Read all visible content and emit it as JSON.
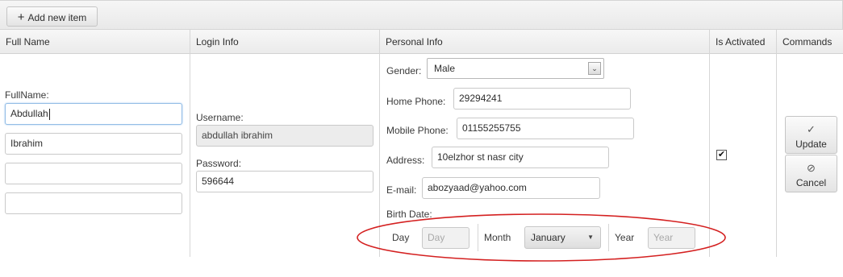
{
  "toolbar": {
    "add_label": "Add new item"
  },
  "columns": {
    "full_name": "Full Name",
    "login_info": "Login Info",
    "personal_info": "Personal Info",
    "is_activated": "Is Activated",
    "commands": "Commands"
  },
  "full_name": {
    "label": "FullName:",
    "fields": [
      "Abdullah",
      "Ibrahim",
      "",
      ""
    ]
  },
  "login": {
    "username_label": "Username:",
    "username_value": "abdullah ibrahim",
    "password_label": "Password:",
    "password_value": "596644"
  },
  "personal": {
    "gender_label": "Gender:",
    "gender_value": "Male",
    "home_phone_label": "Home Phone:",
    "home_phone_value": "29294241",
    "mobile_phone_label": "Mobile Phone:",
    "mobile_phone_value": "01155255755",
    "address_label": "Address:",
    "address_value": "10elzhor st nasr city",
    "email_label": "E-mail:",
    "email_value": "abozyaad@yahoo.com",
    "birth_date_label": "Birth Date:",
    "day_label": "Day",
    "day_placeholder": "Day",
    "month_label": "Month",
    "month_value": "January",
    "year_label": "Year",
    "year_placeholder": "Year"
  },
  "is_activated": {
    "checked": true
  },
  "commands": {
    "update_label": "Update",
    "cancel_label": "Cancel"
  },
  "colors": {
    "annotation_ellipse": "#d42020",
    "focus_border": "#93bde6"
  },
  "icons": {
    "add": "plus-icon",
    "update": "check-icon",
    "cancel": "cancel-icon",
    "gender_dropdown": "chevron-down-icon",
    "month_dropdown": "triangle-down-icon"
  }
}
